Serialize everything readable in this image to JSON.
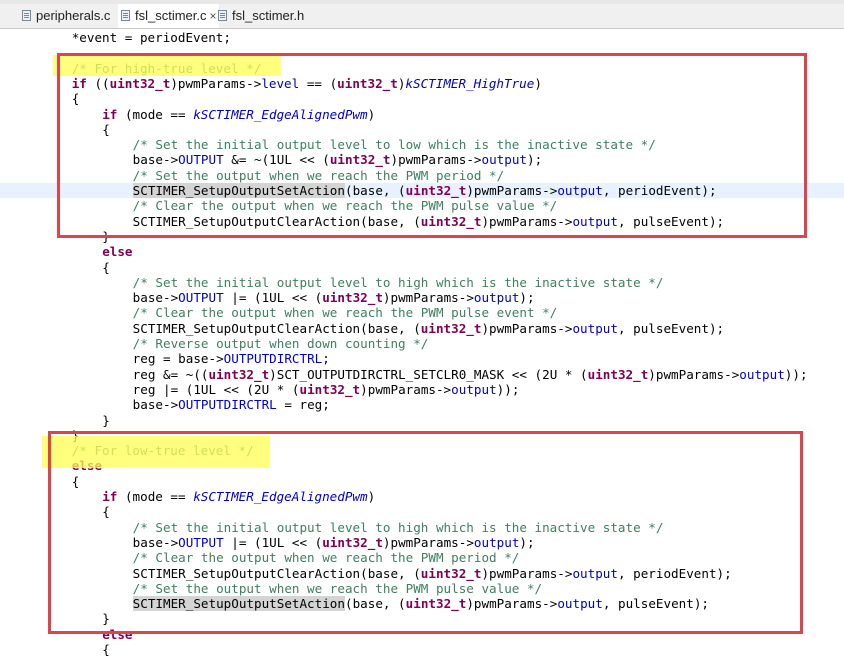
{
  "tabs": [
    {
      "label": "peripherals.c",
      "active": false
    },
    {
      "label": "fsl_sctimer.c",
      "active": true
    },
    {
      "label": "fsl_sctimer.h",
      "active": false
    }
  ],
  "tab_close_glyph": "×",
  "colors": {
    "keyword": "#7f0055",
    "comment": "#3f7f5f",
    "field": "#0000c0",
    "annotation_box": "#e0434b",
    "annotation_highlight": "#ffff52"
  },
  "code_lines": [
    {
      "indent": 6,
      "parts": [
        [
          "p",
          "*event = periodEvent;"
        ]
      ]
    },
    {
      "indent": 6,
      "parts": []
    },
    {
      "indent": 6,
      "parts": [
        [
          "c",
          "/* For high-true level */"
        ]
      ]
    },
    {
      "indent": 6,
      "parts": [
        [
          "k",
          "if"
        ],
        [
          "p",
          " (("
        ],
        [
          "k",
          "uint32_t"
        ],
        [
          "p",
          ")pwmParams->"
        ],
        [
          "f",
          "level"
        ],
        [
          "p",
          " == ("
        ],
        [
          "k",
          "uint32_t"
        ],
        [
          "p",
          ")"
        ],
        [
          "e",
          "kSCTIMER_HighTrue"
        ],
        [
          "p",
          ")"
        ]
      ]
    },
    {
      "indent": 6,
      "parts": [
        [
          "p",
          "{"
        ]
      ]
    },
    {
      "indent": 10,
      "parts": [
        [
          "k",
          "if"
        ],
        [
          "p",
          " (mode == "
        ],
        [
          "e",
          "kSCTIMER_EdgeAlignedPwm"
        ],
        [
          "p",
          ")"
        ]
      ]
    },
    {
      "indent": 10,
      "parts": [
        [
          "p",
          "{"
        ]
      ]
    },
    {
      "indent": 14,
      "parts": [
        [
          "c",
          "/* Set the initial output level to low which is the inactive state */"
        ]
      ]
    },
    {
      "indent": 14,
      "parts": [
        [
          "p",
          "base->"
        ],
        [
          "f",
          "OUTPUT"
        ],
        [
          "p",
          " &= ~(1UL << ("
        ],
        [
          "k",
          "uint32_t"
        ],
        [
          "p",
          ")pwmParams->"
        ],
        [
          "f",
          "output"
        ],
        [
          "p",
          ");"
        ]
      ]
    },
    {
      "indent": 14,
      "parts": [
        [
          "c",
          "/* Set the output when we reach the PWM period */"
        ]
      ]
    },
    {
      "indent": 14,
      "current": true,
      "parts": [
        [
          "s",
          "SCTIMER_SetupOutputSetAction"
        ],
        [
          "p",
          "(base, ("
        ],
        [
          "k",
          "uint32_t"
        ],
        [
          "p",
          ")pwmParams->"
        ],
        [
          "f",
          "output"
        ],
        [
          "p",
          ", periodEvent);"
        ]
      ]
    },
    {
      "indent": 14,
      "parts": [
        [
          "c",
          "/* Clear the output when we reach the PWM pulse value */"
        ]
      ]
    },
    {
      "indent": 14,
      "parts": [
        [
          "p",
          "SCTIMER_SetupOutputClearAction(base, ("
        ],
        [
          "k",
          "uint32_t"
        ],
        [
          "p",
          ")pwmParams->"
        ],
        [
          "f",
          "output"
        ],
        [
          "p",
          ", pulseEvent);"
        ]
      ]
    },
    {
      "indent": 10,
      "parts": [
        [
          "p",
          "}"
        ]
      ]
    },
    {
      "indent": 10,
      "parts": [
        [
          "k",
          "else"
        ]
      ]
    },
    {
      "indent": 10,
      "parts": [
        [
          "p",
          "{"
        ]
      ]
    },
    {
      "indent": 14,
      "parts": [
        [
          "c",
          "/* Set the initial output level to high which is the inactive state */"
        ]
      ]
    },
    {
      "indent": 14,
      "parts": [
        [
          "p",
          "base->"
        ],
        [
          "f",
          "OUTPUT"
        ],
        [
          "p",
          " |= (1UL << ("
        ],
        [
          "k",
          "uint32_t"
        ],
        [
          "p",
          ")pwmParams->"
        ],
        [
          "f",
          "output"
        ],
        [
          "p",
          ");"
        ]
      ]
    },
    {
      "indent": 14,
      "parts": [
        [
          "c",
          "/* Clear the output when we reach the PWM pulse event */"
        ]
      ]
    },
    {
      "indent": 14,
      "parts": [
        [
          "p",
          "SCTIMER_SetupOutputClearAction(base, ("
        ],
        [
          "k",
          "uint32_t"
        ],
        [
          "p",
          ")pwmParams->"
        ],
        [
          "f",
          "output"
        ],
        [
          "p",
          ", pulseEvent);"
        ]
      ]
    },
    {
      "indent": 14,
      "parts": [
        [
          "c",
          "/* Reverse output when down counting */"
        ]
      ]
    },
    {
      "indent": 14,
      "parts": [
        [
          "p",
          "reg = base->"
        ],
        [
          "f",
          "OUTPUTDIRCTRL"
        ],
        [
          "p",
          ";"
        ]
      ]
    },
    {
      "indent": 14,
      "parts": [
        [
          "p",
          "reg &= ~(("
        ],
        [
          "k",
          "uint32_t"
        ],
        [
          "p",
          ")SCT_OUTPUTDIRCTRL_SETCLR0_MASK << (2U * ("
        ],
        [
          "k",
          "uint32_t"
        ],
        [
          "p",
          ")pwmParams->"
        ],
        [
          "f",
          "output"
        ],
        [
          "p",
          "));"
        ]
      ]
    },
    {
      "indent": 14,
      "parts": [
        [
          "p",
          "reg |= (1UL << (2U * ("
        ],
        [
          "k",
          "uint32_t"
        ],
        [
          "p",
          ")pwmParams->"
        ],
        [
          "f",
          "output"
        ],
        [
          "p",
          "));"
        ]
      ]
    },
    {
      "indent": 14,
      "parts": [
        [
          "p",
          "base->"
        ],
        [
          "f",
          "OUTPUTDIRCTRL"
        ],
        [
          "p",
          " = reg;"
        ]
      ]
    },
    {
      "indent": 10,
      "parts": [
        [
          "p",
          "}"
        ]
      ]
    },
    {
      "indent": 6,
      "parts": [
        [
          "p",
          "}"
        ]
      ]
    },
    {
      "indent": 6,
      "parts": [
        [
          "c",
          "/* For low-true level */"
        ]
      ]
    },
    {
      "indent": 6,
      "parts": [
        [
          "k",
          "else"
        ]
      ]
    },
    {
      "indent": 6,
      "parts": [
        [
          "p",
          "{"
        ]
      ]
    },
    {
      "indent": 10,
      "parts": [
        [
          "k",
          "if"
        ],
        [
          "p",
          " (mode == "
        ],
        [
          "e",
          "kSCTIMER_EdgeAlignedPwm"
        ],
        [
          "p",
          ")"
        ]
      ]
    },
    {
      "indent": 10,
      "parts": [
        [
          "p",
          "{"
        ]
      ]
    },
    {
      "indent": 14,
      "parts": [
        [
          "c",
          "/* Set the initial output level to high which is the inactive state */"
        ]
      ]
    },
    {
      "indent": 14,
      "parts": [
        [
          "p",
          "base->"
        ],
        [
          "f",
          "OUTPUT"
        ],
        [
          "p",
          " |= (1UL << ("
        ],
        [
          "k",
          "uint32_t"
        ],
        [
          "p",
          ")pwmParams->"
        ],
        [
          "f",
          "output"
        ],
        [
          "p",
          ");"
        ]
      ]
    },
    {
      "indent": 14,
      "parts": [
        [
          "c",
          "/* Clear the output when we reach the PWM period */"
        ]
      ]
    },
    {
      "indent": 14,
      "parts": [
        [
          "p",
          "SCTIMER_SetupOutputClearAction(base, ("
        ],
        [
          "k",
          "uint32_t"
        ],
        [
          "p",
          ")pwmParams->"
        ],
        [
          "f",
          "output"
        ],
        [
          "p",
          ", periodEvent);"
        ]
      ]
    },
    {
      "indent": 14,
      "parts": [
        [
          "c",
          "/* Set the output when we reach the PWM pulse value */"
        ]
      ]
    },
    {
      "indent": 14,
      "parts": [
        [
          "s",
          "SCTIMER_SetupOutputSetAction"
        ],
        [
          "p",
          "(base, ("
        ],
        [
          "k",
          "uint32_t"
        ],
        [
          "p",
          ")pwmParams->"
        ],
        [
          "f",
          "output"
        ],
        [
          "p",
          ", pulseEvent);"
        ]
      ]
    },
    {
      "indent": 10,
      "parts": [
        [
          "p",
          "}"
        ]
      ]
    },
    {
      "indent": 10,
      "parts": [
        [
          "k",
          "else"
        ]
      ]
    },
    {
      "indent": 10,
      "parts": [
        [
          "p",
          "{"
        ]
      ]
    }
  ]
}
